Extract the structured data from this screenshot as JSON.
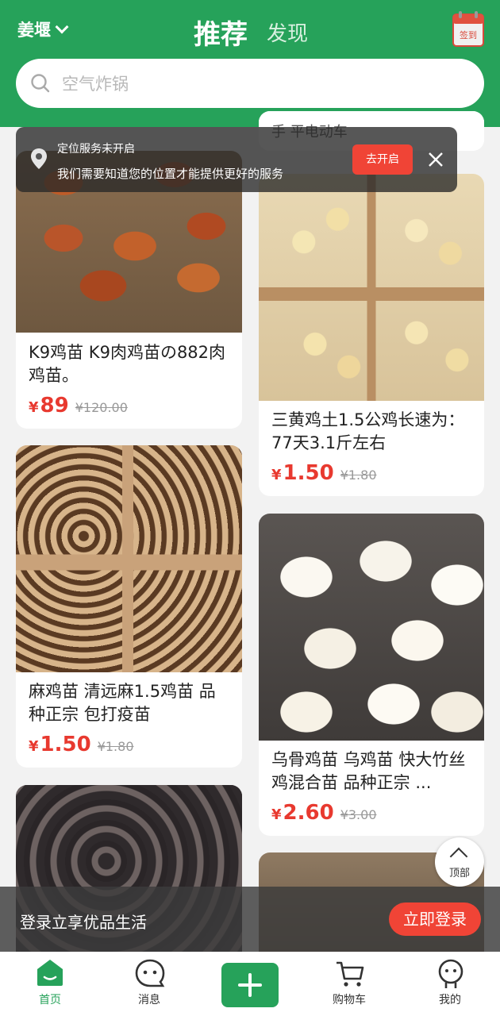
{
  "header": {
    "location": "姜堰",
    "tab_recommend": "推荐",
    "tab_discover": "发现",
    "signin_label": "签到"
  },
  "search": {
    "placeholder": "空气炸锅"
  },
  "location_banner": {
    "title": "定位服务未开启",
    "message": "我们需要知道您的位置才能提供更好的服务",
    "open_button": "去开启"
  },
  "products": [
    {
      "title": "K9鸡苗 K9肉鸡苗の882肉鸡苗。",
      "currency": "¥",
      "price": "89",
      "old_price": "¥120.00"
    },
    {
      "title": "三黄鸡土1.5公鸡长速为：77天3.1斤左右",
      "currency": "¥",
      "price": "1.50",
      "old_price": "¥1.80"
    },
    {
      "title": "麻鸡苗 清远麻1.5鸡苗 品种正宗 包打疫苗",
      "currency": "¥",
      "price": "1.50",
      "old_price": "¥1.80"
    },
    {
      "title": "乌骨鸡苗 乌鸡苗 快大竹丝鸡混合苗 品种正宗 ...",
      "currency": "¥",
      "price": "2.60",
      "old_price": "¥3.00"
    }
  ],
  "hidden_card_fragment": "手  平电动车",
  "top_button": "顶部",
  "login_bar": {
    "message": "登录立享优品生活",
    "button": "立即登录"
  },
  "nav": {
    "home": "首页",
    "messages": "消息",
    "cart": "购物车",
    "mine": "我的"
  },
  "colors": {
    "brand_green": "#26a25a",
    "price_red": "#e8392f",
    "button_red": "#f04436"
  }
}
